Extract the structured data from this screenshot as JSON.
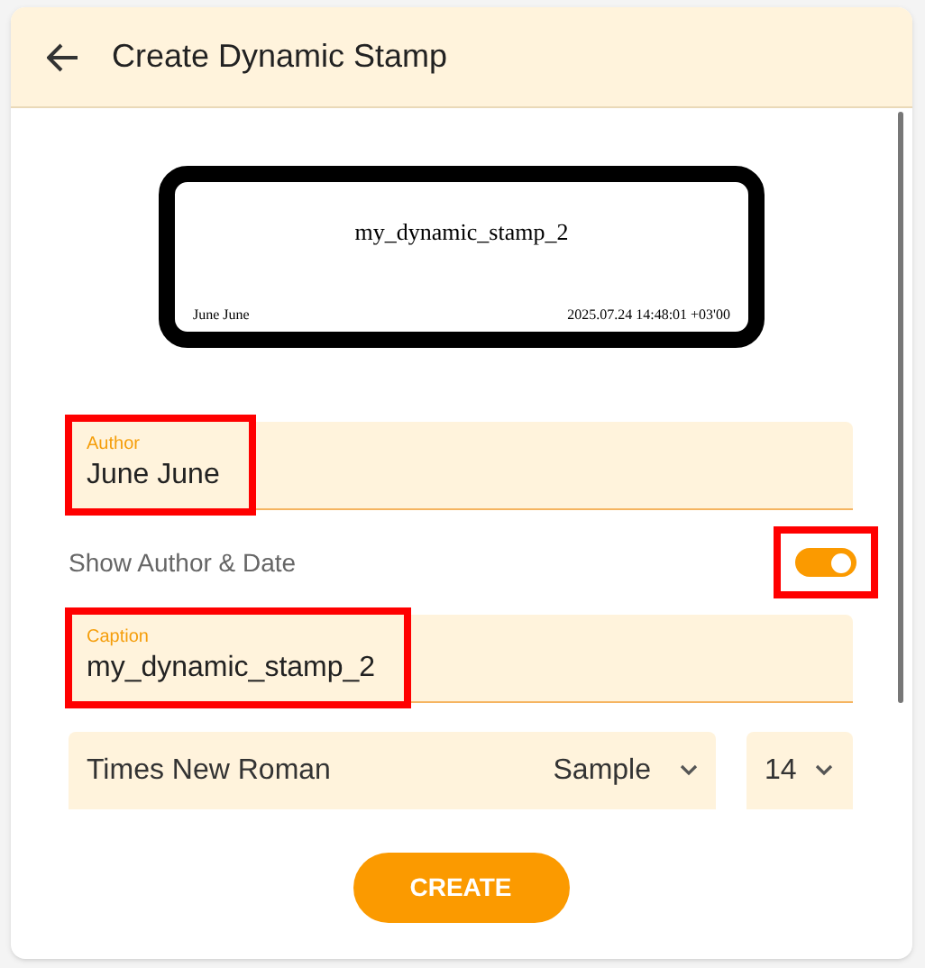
{
  "dialog": {
    "title": "Create Dynamic Stamp"
  },
  "preview": {
    "caption": "my_dynamic_stamp_2",
    "author": "June June",
    "date": "2025.07.24 14:48:01 +03'00"
  },
  "author_field": {
    "label": "Author",
    "value": "June June",
    "highlighted": true
  },
  "show_author_date": {
    "label": "Show Author & Date",
    "on": true,
    "highlighted": true
  },
  "caption_field": {
    "label": "Caption",
    "value": "my_dynamic_stamp_2",
    "highlighted": true
  },
  "font_select": {
    "value": "Times New Roman",
    "sample": "Sample"
  },
  "size_select": {
    "value": "14"
  },
  "create_button": "CREATE"
}
